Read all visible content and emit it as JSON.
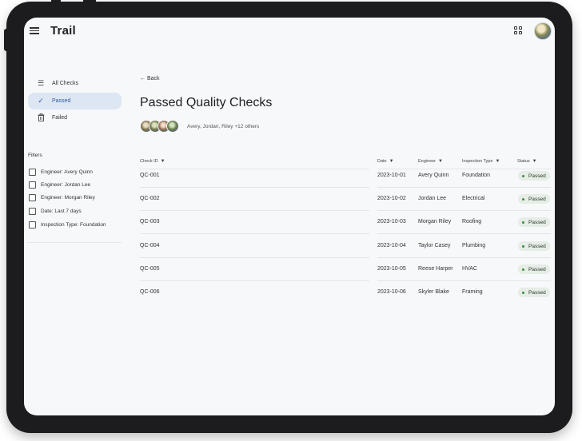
{
  "app": {
    "title": "Trail"
  },
  "nav": {
    "items": [
      {
        "label": "All Checks",
        "icon": "list-icon"
      },
      {
        "label": "Passed",
        "icon": "check-icon",
        "active": true
      },
      {
        "label": "Failed",
        "icon": "trash-icon"
      }
    ]
  },
  "filters": {
    "label": "Filters",
    "items": [
      {
        "label": "Engineer: Avery Quinn",
        "checked": false
      },
      {
        "label": "Engineer: Jordan Lee",
        "checked": false
      },
      {
        "label": "Engineer: Morgan Riley",
        "checked": false
      },
      {
        "label": "Date: Last 7 days",
        "checked": false
      },
      {
        "label": "Inspection Type: Foundation",
        "checked": false
      }
    ]
  },
  "main": {
    "back_label": "← Back",
    "title": "Passed Quality Checks",
    "avatars_text": "Avery, Jordan, Riley +12 others"
  },
  "table": {
    "headers": [
      "Check ID",
      "Date",
      "Engineer",
      "Inspection Type",
      "Status"
    ],
    "caret": "▼",
    "rows": [
      {
        "id": "QC-001",
        "date": "2023-10-01",
        "engineer": "Avery Quinn",
        "type": "Foundation",
        "status": "Passed"
      },
      {
        "id": "QC-002",
        "date": "2023-10-02",
        "engineer": "Jordan Lee",
        "type": "Electrical",
        "status": "Passed"
      },
      {
        "id": "QC-003",
        "date": "2023-10-03",
        "engineer": "Morgan Riley",
        "type": "Roofing",
        "status": "Passed"
      },
      {
        "id": "QC-004",
        "date": "2023-10-04",
        "engineer": "Taylor Casey",
        "type": "Plumbing",
        "status": "Passed"
      },
      {
        "id": "QC-005",
        "date": "2023-10-05",
        "engineer": "Reese Harper",
        "type": "HVAC",
        "status": "Passed"
      },
      {
        "id": "QC-006",
        "date": "2023-10-06",
        "engineer": "Skyler Blake",
        "type": "Framing",
        "status": "Passed"
      }
    ]
  },
  "colors": {
    "accent": "#2e5b9a",
    "active_bg": "#dde6f3",
    "status_dot": "#3e8e41"
  }
}
